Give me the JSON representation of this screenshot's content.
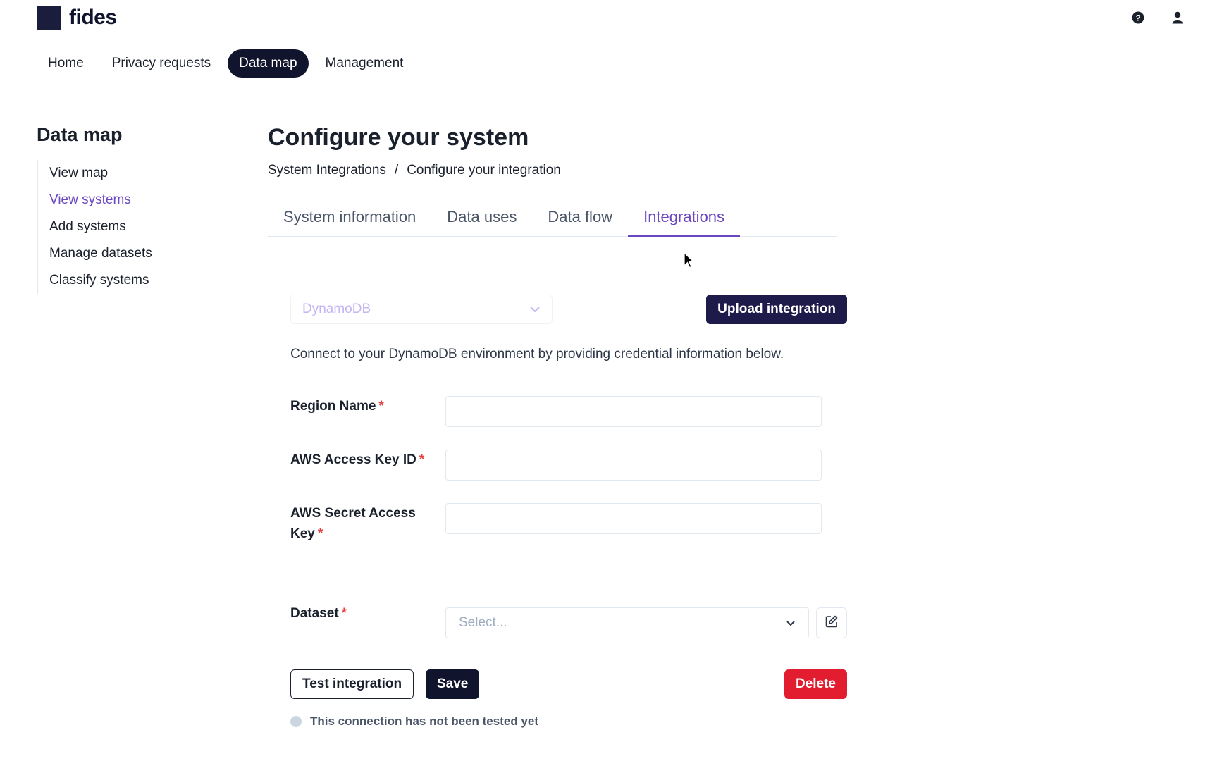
{
  "brand": {
    "name": "fides"
  },
  "header": {
    "icons": [
      "question-circle-icon",
      "user-icon"
    ]
  },
  "topnav": {
    "items": [
      {
        "label": "Home"
      },
      {
        "label": "Privacy requests"
      },
      {
        "label": "Data map",
        "active": true
      },
      {
        "label": "Management"
      }
    ]
  },
  "sidebar": {
    "title": "Data map",
    "items": [
      {
        "label": "View map"
      },
      {
        "label": "View systems",
        "active": true
      },
      {
        "label": "Add systems"
      },
      {
        "label": "Manage datasets"
      },
      {
        "label": "Classify systems"
      }
    ]
  },
  "main": {
    "title": "Configure your system",
    "breadcrumb": {
      "parent": "System Integrations",
      "separator": "/",
      "current": "Configure your integration"
    },
    "tabs": [
      {
        "label": "System information"
      },
      {
        "label": "Data uses"
      },
      {
        "label": "Data flow"
      },
      {
        "label": "Integrations",
        "active": true
      }
    ],
    "integration_type": {
      "value": "DynamoDB"
    },
    "upload_label": "Upload integration",
    "description": "Connect to your DynamoDB environment by providing credential information below.",
    "form": {
      "region_label": "Region Name",
      "access_key_label": "AWS Access Key ID",
      "secret_key_label_line1": "AWS Secret Access",
      "secret_key_label_line2": "Key",
      "dataset_label": "Dataset",
      "required_marker": "*",
      "region_value": "",
      "access_key_value": "",
      "secret_key_value": "",
      "dataset_placeholder": "Select..."
    },
    "actions": {
      "test_label": "Test integration",
      "save_label": "Save",
      "delete_label": "Delete"
    },
    "status_text": "This connection has not been tested yet"
  },
  "colors": {
    "brand_dark": "#11142d",
    "accent_purple": "#6b46c1",
    "danger": "#e11d2f",
    "required": "#e53e3e"
  }
}
